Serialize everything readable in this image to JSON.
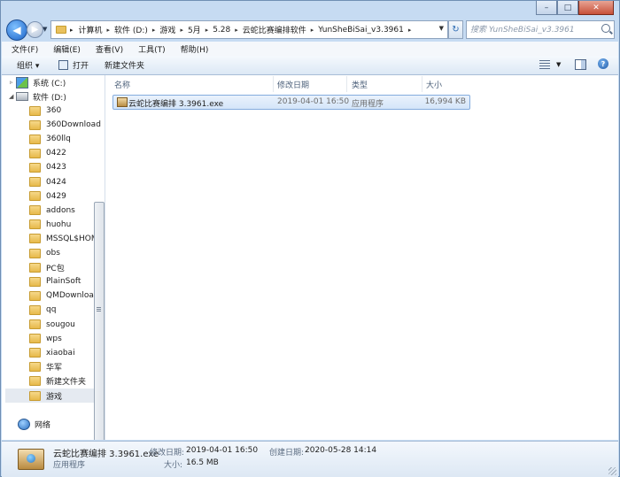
{
  "window": {
    "caption": {
      "minimize": "–",
      "maximize": "□",
      "close": "✕"
    }
  },
  "address": {
    "breadcrumbs": [
      "计算机",
      "软件 (D:)",
      "游戏",
      "5月",
      "5.28",
      "云蛇比赛编排软件",
      "YunSheBiSai_v3.3961"
    ],
    "search_placeholder": "搜索 YunSheBiSai_v3.3961"
  },
  "menubar": {
    "items": [
      "文件(F)",
      "编辑(E)",
      "查看(V)",
      "工具(T)",
      "帮助(H)"
    ]
  },
  "toolbar": {
    "organize": "组织 ▾",
    "open": "打开",
    "new_folder": "新建文件夹"
  },
  "nav": {
    "drive_c": "系统 (C:)",
    "drive_d": "软件 (D:)",
    "folders": [
      "360",
      "360Download",
      "360llq",
      "0422",
      "0423",
      "0424",
      "0429",
      "addons",
      "huohu",
      "MSSQL$HOM",
      "obs",
      "PC包",
      "PlainSoft",
      "QMDownload",
      "qq",
      "sougou",
      "wps",
      "xiaobai",
      "华军",
      "新建文件夹",
      "游戏"
    ],
    "selected_folder": "游戏",
    "network": "网络"
  },
  "columns": {
    "name": "名称",
    "date": "修改日期",
    "type": "类型",
    "size": "大小"
  },
  "files": [
    {
      "name": "云蛇比赛编排 3.3961.exe",
      "date": "2019-04-01 16:50",
      "type": "应用程序",
      "size": "16,994 KB"
    }
  ],
  "details": {
    "name": "云蛇比赛编排 3.3961.exe",
    "type": "应用程序",
    "modified_label": "修改日期:",
    "modified": "2019-04-01 16:50",
    "size_label": "大小:",
    "size": "16.5 MB",
    "created_label": "创建日期:",
    "created": "2020-05-28 14:14"
  },
  "icons": {
    "back": "back-arrow-icon",
    "forward": "forward-arrow-icon",
    "search": "magnifier-icon",
    "help": "help-icon"
  }
}
